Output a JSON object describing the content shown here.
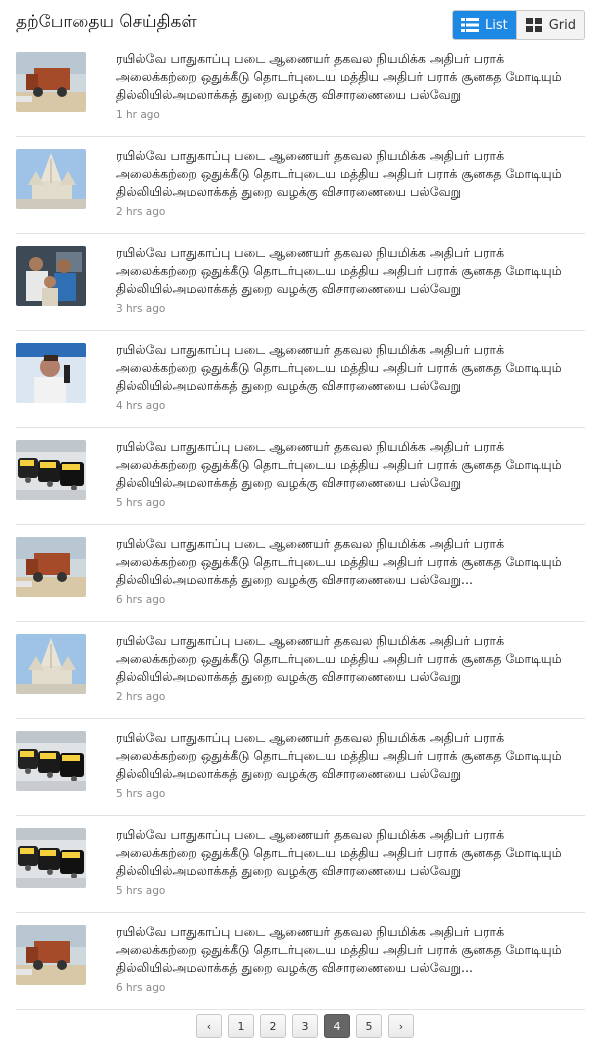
{
  "header": {
    "title": "தற்போதைய செய்திகள்",
    "list_label": "List",
    "grid_label": "Grid"
  },
  "news": [
    {
      "headline": "ரயில்வே பாதுகாப்பு படை ஆணையர் தகவல நியமிக்க  அதிபர் பராக் அலைக்கற்றை ஒதுக்கீடு தொடர்புடைய மத்திய  அதிபர் பராக் சூனகத மோடியும் தில்லியில்அமலாக்கத் துறை வழக்கு விசாரணையை பல்வேறு",
      "time": "1 hr ago",
      "image": "truck"
    },
    {
      "headline": "ரயில்வே பாதுகாப்பு படை ஆணையர் தகவல நியமிக்க  அதிபர் பராக் அலைக்கற்றை ஒதுக்கீடு தொடர்புடைய மத்திய  அதிபர் பராக் சூனகத மோடியும் தில்லியில்அமலாக்கத் துறை வழக்கு விசாரணையை பல்வேறு",
      "time": "2 hrs ago",
      "image": "temple"
    },
    {
      "headline": "ரயில்வே பாதுகாப்பு படை ஆணையர் தகவல நியமிக்க  அதிபர் பராக் அலைக்கற்றை ஒதுக்கீடு தொடர்புடைய மத்திய  அதிபர் பராக் சூனகத மோடியும் தில்லியில்அமலாக்கத் துறை வழக்கு விசாரணையை பல்வேறு",
      "time": "3 hrs ago",
      "image": "crowd"
    },
    {
      "headline": "ரயில்வே பாதுகாப்பு படை ஆணையர் தகவல நியமிக்க  அதிபர் பராக் அலைக்கற்றை ஒதுக்கீடு தொடர்புடைய மத்திய  அதிபர் பராக் சூனகத மோடியும் தில்லியில்அமலாக்கத் துறை வழக்கு விசாரணையை பல்வேறு",
      "time": "4 hrs ago",
      "image": "person"
    },
    {
      "headline": "ரயில்வே பாதுகாப்பு படை ஆணையர் தகவல நியமிக்க  அதிபர் பராக் அலைக்கற்றை ஒதுக்கீடு தொடர்புடைய மத்திய  அதிபர் பராக் சூனகத மோடியும் தில்லியில்அமலாக்கத் துறை வழக்கு விசாரணையை பல்வேறு",
      "time": "5 hrs ago",
      "image": "taxis"
    },
    {
      "headline": "ரயில்வே பாதுகாப்பு படை ஆணையர் தகவல நியமிக்க  அதிபர் பராக் அலைக்கற்றை ஒதுக்கீடு தொடர்புடைய மத்திய  அதிபர் பராக் சூனகத மோடியும் தில்லியில்அமலாக்கத் துறை வழக்கு விசாரணையை பல்வேறு...",
      "time": "6 hrs ago",
      "image": "truck"
    },
    {
      "headline": "ரயில்வே பாதுகாப்பு படை ஆணையர் தகவல நியமிக்க  அதிபர் பராக் அலைக்கற்றை ஒதுக்கீடு தொடர்புடைய மத்திய  அதிபர் பராக் சூனகத மோடியும் தில்லியில்அமலாக்கத் துறை வழக்கு விசாரணையை பல்வேறு",
      "time": "2 hrs ago",
      "image": "temple"
    },
    {
      "headline": "ரயில்வே பாதுகாப்பு படை ஆணையர் தகவல நியமிக்க  அதிபர் பராக் அலைக்கற்றை ஒதுக்கீடு தொடர்புடைய மத்திய  அதிபர் பராக் சூனகத மோடியும் தில்லியில்அமலாக்கத் துறை வழக்கு விசாரணையை பல்வேறு",
      "time": "5 hrs ago",
      "image": "taxis"
    },
    {
      "headline": "ரயில்வே பாதுகாப்பு படை ஆணையர் தகவல நியமிக்க  அதிபர் பராக் அலைக்கற்றை ஒதுக்கீடு தொடர்புடைய மத்திய  அதிபர் பராக் சூனகத மோடியும் தில்லியில்அமலாக்கத் துறை வழக்கு விசாரணையை பல்வேறு",
      "time": "5 hrs ago",
      "image": "taxis"
    },
    {
      "headline": "ரயில்வே பாதுகாப்பு படை ஆணையர் தகவல நியமிக்க  அதிபர் பராக் அலைக்கற்றை ஒதுக்கீடு தொடர்புடைய மத்திய  அதிபர் பராக் சூனகத மோடியும் தில்லியில்அமலாக்கத் துறை வழக்கு விசாரணையை பல்வேறு...",
      "time": "6 hrs ago",
      "image": "truck"
    }
  ],
  "pagination": {
    "prev": "‹",
    "pages": [
      "1",
      "2",
      "3",
      "4",
      "5"
    ],
    "current": "4",
    "next": "›"
  }
}
